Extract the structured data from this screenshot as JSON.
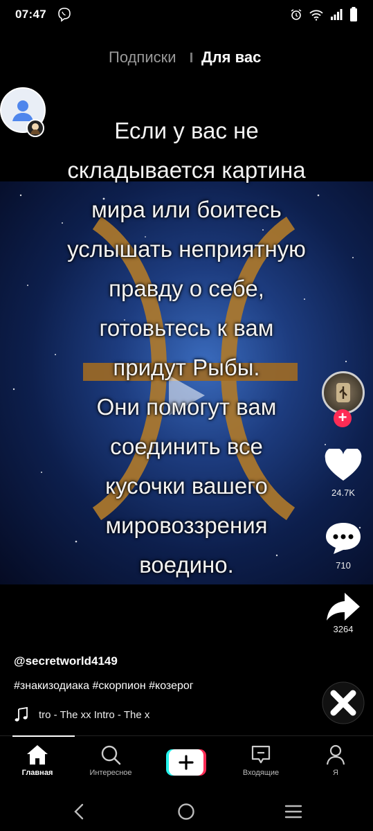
{
  "status_bar": {
    "time": "07:47"
  },
  "feed_tabs": {
    "following": "Подписки",
    "for_you": "Для вас"
  },
  "video": {
    "caption_lines": [
      "Если у вас не",
      "складывается картина",
      "мира или боитесь",
      "услышать неприятную",
      "правду о себе,",
      "готовьтесь к вам",
      "придут Рыбы.",
      "Они помогут вам",
      "соединить все",
      "кусочки вашего",
      "мировоззрения",
      "воедино."
    ]
  },
  "actions": {
    "likes": "24.7K",
    "comments": "710",
    "shares": "3264"
  },
  "post": {
    "username": "@secretworld4149",
    "hashtags": "#знакизодиака #скорпион #козерог",
    "music": "tro - The xx     Intro - The x"
  },
  "nav": {
    "home": "Главная",
    "discover": "Интересное",
    "inbox": "Входящие",
    "me": "Я"
  },
  "colors": {
    "accent": "#fe2c55",
    "cyan": "#25f4ee"
  }
}
